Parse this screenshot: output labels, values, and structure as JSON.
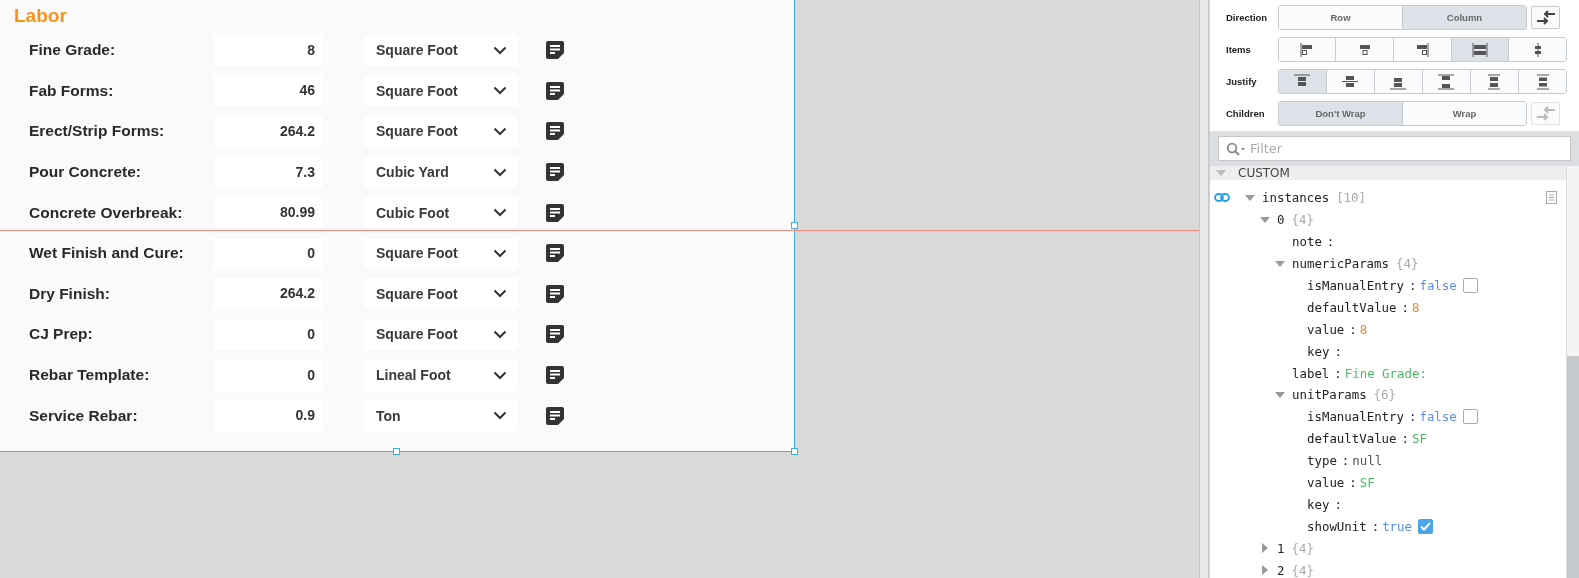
{
  "canvas": {
    "title": "Labor",
    "rows": [
      {
        "label": "Fine Grade:",
        "value": "8",
        "unit": "Square Foot"
      },
      {
        "label": "Fab Forms:",
        "value": "46",
        "unit": "Square Foot"
      },
      {
        "label": "Erect/Strip Forms:",
        "value": "264.2",
        "unit": "Square Foot"
      },
      {
        "label": "Pour Concrete:",
        "value": "7.3",
        "unit": "Cubic Yard"
      },
      {
        "label": "Concrete Overbreak:",
        "value": "80.99",
        "unit": "Cubic Foot"
      },
      {
        "label": "Wet Finish and Cure:",
        "value": "0",
        "unit": "Square Foot"
      },
      {
        "label": "Dry Finish:",
        "value": "264.2",
        "unit": "Square Foot"
      },
      {
        "label": "CJ Prep:",
        "value": "0",
        "unit": "Square Foot"
      },
      {
        "label": "Rebar Template:",
        "value": "0",
        "unit": "Lineal Foot"
      },
      {
        "label": "Service Rebar:",
        "value": "0.9",
        "unit": "Ton"
      }
    ]
  },
  "layout": {
    "direction": {
      "label": "Direction",
      "options": [
        {
          "label": "Row",
          "selected": false
        },
        {
          "label": "Column",
          "selected": true
        }
      ]
    },
    "items": {
      "label": "Items",
      "options": [
        {
          "kind": "start",
          "selected": false
        },
        {
          "kind": "center",
          "selected": false
        },
        {
          "kind": "end",
          "selected": false
        },
        {
          "kind": "stretch",
          "selected": true
        },
        {
          "kind": "baseline",
          "selected": false
        }
      ]
    },
    "justify": {
      "label": "Justify",
      "options": [
        {
          "kind": "start",
          "selected": true
        },
        {
          "kind": "center",
          "selected": false
        },
        {
          "kind": "end",
          "selected": false
        },
        {
          "kind": "between",
          "selected": false
        },
        {
          "kind": "around",
          "selected": false
        },
        {
          "kind": "evenly",
          "selected": false
        }
      ]
    },
    "children": {
      "label": "Children",
      "options": [
        {
          "label": "Don't Wrap",
          "selected": true
        },
        {
          "label": "Wrap",
          "selected": false
        }
      ]
    }
  },
  "filter": {
    "placeholder": "Filter"
  },
  "tree": {
    "section": "CUSTOM",
    "nodes": [
      {
        "key": "instances",
        "count": "[10]",
        "expanded": true,
        "children": [
          {
            "key": "0",
            "count": "{4}",
            "expanded": true,
            "children": [
              {
                "key": "note",
                "separator": ":"
              },
              {
                "key": "numericParams",
                "count": "{4}",
                "expanded": true,
                "children": [
                  {
                    "key": "isManualEntry",
                    "separator": ":",
                    "value": "false",
                    "kind": "boolean",
                    "checked": false
                  },
                  {
                    "key": "defaultValue",
                    "separator": ":",
                    "value": "8",
                    "kind": "number"
                  },
                  {
                    "key": "value",
                    "separator": ":",
                    "value": "8",
                    "kind": "number"
                  },
                  {
                    "key": "key",
                    "separator": ":"
                  }
                ]
              },
              {
                "key": "label",
                "separator": ":",
                "value": "Fine Grade:",
                "kind": "string"
              },
              {
                "key": "unitParams",
                "count": "{6}",
                "expanded": true,
                "children": [
                  {
                    "key": "isManualEntry",
                    "separator": ":",
                    "value": "false",
                    "kind": "boolean",
                    "checked": false
                  },
                  {
                    "key": "defaultValue",
                    "separator": ":",
                    "value": "SF",
                    "kind": "string"
                  },
                  {
                    "key": "type",
                    "separator": ":",
                    "value": "null",
                    "kind": "null"
                  },
                  {
                    "key": "value",
                    "separator": ":",
                    "value": "SF",
                    "kind": "string"
                  },
                  {
                    "key": "key",
                    "separator": ":"
                  },
                  {
                    "key": "showUnit",
                    "separator": ":",
                    "value": "true",
                    "kind": "boolean",
                    "checked": true
                  }
                ]
              }
            ]
          },
          {
            "key": "1",
            "count": "{4}",
            "expanded": false
          },
          {
            "key": "2",
            "count": "{4}",
            "expanded": false
          }
        ]
      }
    ]
  }
}
